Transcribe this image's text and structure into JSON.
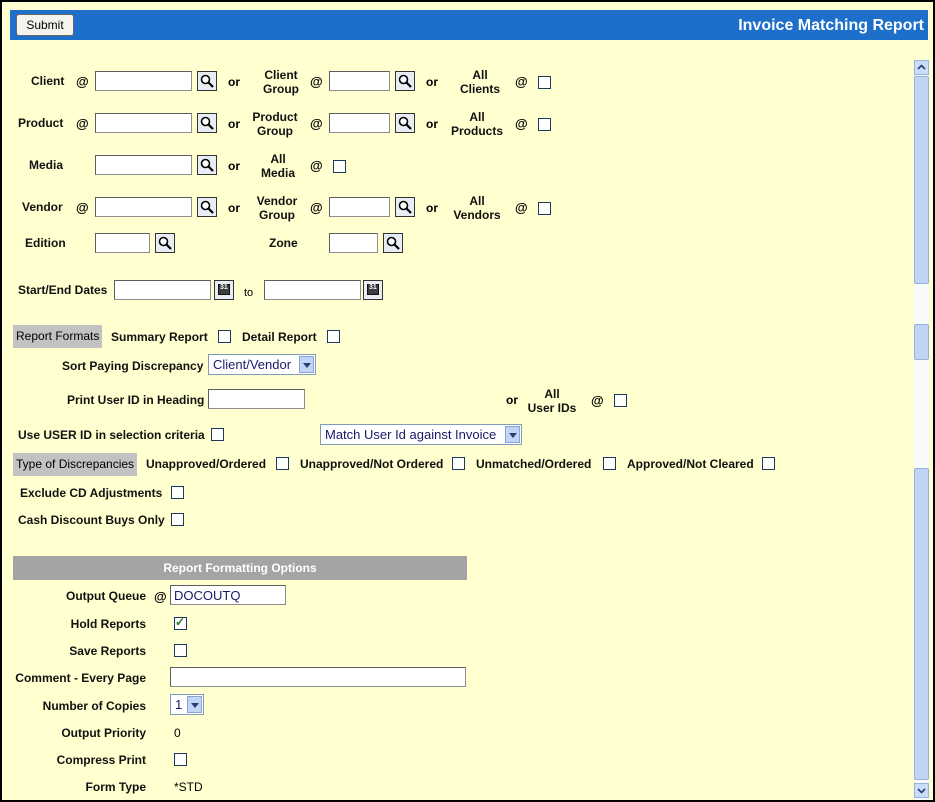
{
  "header": {
    "submit_label": "Submit",
    "title": "Invoice Matching Report"
  },
  "criteria": {
    "client": "Client",
    "client_group": "Client\nGroup",
    "all_clients": "All\nClients",
    "product": "Product",
    "product_group": "Product\nGroup",
    "all_products": "All\nProducts",
    "media": "Media",
    "all_media": "All\nMedia",
    "vendor": "Vendor",
    "vendor_group": "Vendor\nGroup",
    "all_vendors": "All\nVendors",
    "edition": "Edition",
    "zone": "Zone",
    "at": "@",
    "or": "or"
  },
  "dates": {
    "label": "Start/End Dates",
    "to": "to"
  },
  "report_formats": {
    "section": "Report Formats",
    "summary": "Summary Report",
    "detail": "Detail Report"
  },
  "sort": {
    "label": "Sort Paying Discrepancy",
    "selected": "Client/Vendor"
  },
  "user": {
    "print_label": "Print User ID in Heading",
    "or": "or",
    "all_user_ids": "All\nUser IDs",
    "at": "@",
    "use_label": "Use USER ID in selection criteria",
    "match_selected": "Match User Id against Invoice"
  },
  "discrepancies": {
    "section": "Type of Discrepancies",
    "unapproved_ordered": "Unapproved/Ordered",
    "unapproved_not_ordered": "Unapproved/Not Ordered",
    "unmatched_ordered": "Unmatched/Ordered",
    "approved_not_cleared": "Approved/Not Cleared"
  },
  "options": {
    "exclude_cd": "Exclude CD Adjustments",
    "cash_discount": "Cash Discount Buys Only"
  },
  "formatting": {
    "header": "Report Formatting Options",
    "output_queue_label": "Output Queue",
    "at": "@",
    "output_queue_value": "DOCOUTQ",
    "hold_reports": "Hold Reports",
    "hold_checked": true,
    "save_reports": "Save Reports",
    "comment_label": "Comment - Every Page",
    "copies_label": "Number of Copies",
    "copies_value": "1",
    "priority_label": "Output Priority",
    "priority_value": "0",
    "compress_label": "Compress Print",
    "form_type_label": "Form Type",
    "form_type_value": "*STD"
  },
  "icons": {
    "lookup": "magnifier-icon",
    "calendar": "calendar-icon"
  }
}
